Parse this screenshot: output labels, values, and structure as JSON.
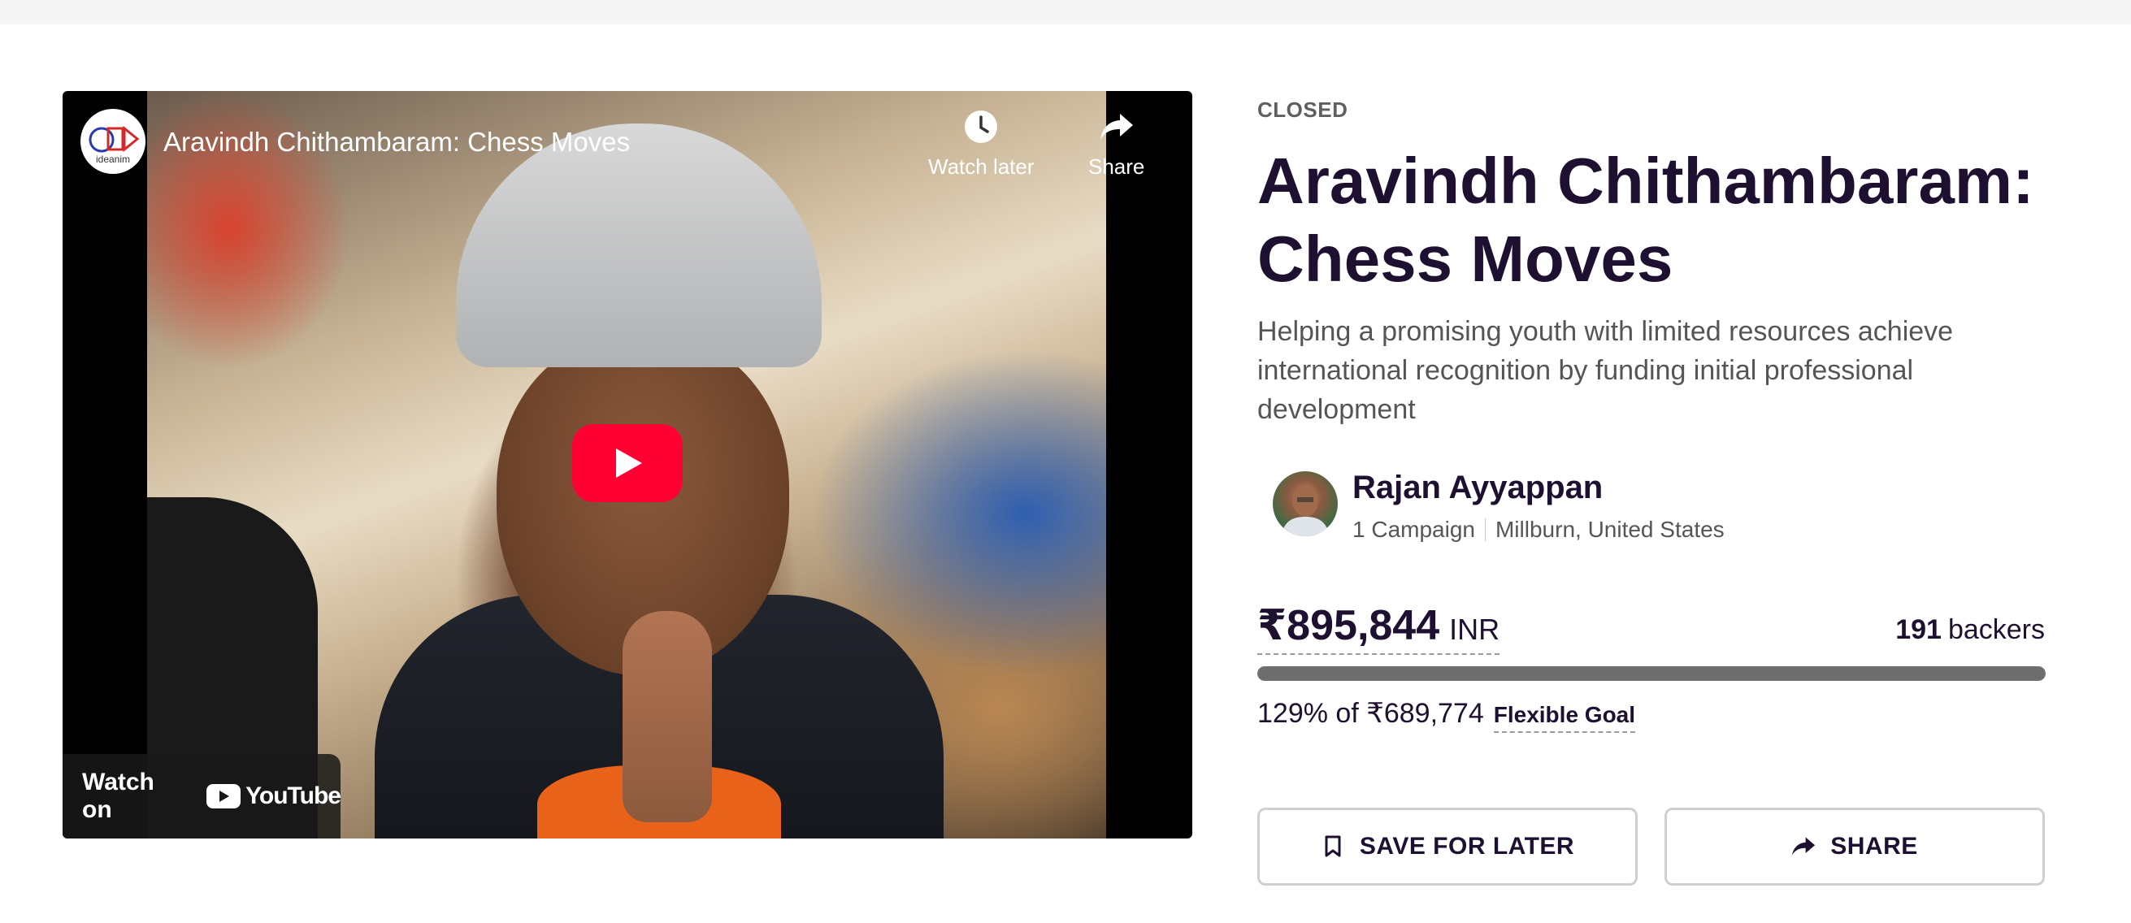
{
  "video": {
    "title": "Aravindh Chithambaram: Chess Moves",
    "channel_avatar_text": "ideanim",
    "watch_later_label": "Watch later",
    "share_label": "Share",
    "watch_on_label": "Watch on",
    "youtube_label": "YouTube"
  },
  "campaign": {
    "status": "CLOSED",
    "title": "Aravindh Chithambaram: Chess Moves",
    "subtitle": "Helping a promising youth with limited resources achieve international recognition by funding initial professional development"
  },
  "owner": {
    "name": "Rajan Ayyappan",
    "campaigns": "1 Campaign",
    "location": "Millburn, United States"
  },
  "funding": {
    "amount": "₹895,844",
    "currency": "INR",
    "backers_count": "191",
    "backers_label": "backers",
    "progress_fraction": 1.0,
    "percent_text": "129% of ₹689,774",
    "goal_type": "Flexible Goal"
  },
  "actions": {
    "save_label": "SAVE FOR LATER",
    "share_label": "SHARE"
  },
  "colors": {
    "primary_text": "#1e1030",
    "progress_fill": "#6e6e6e",
    "youtube_red": "#ff0033"
  }
}
